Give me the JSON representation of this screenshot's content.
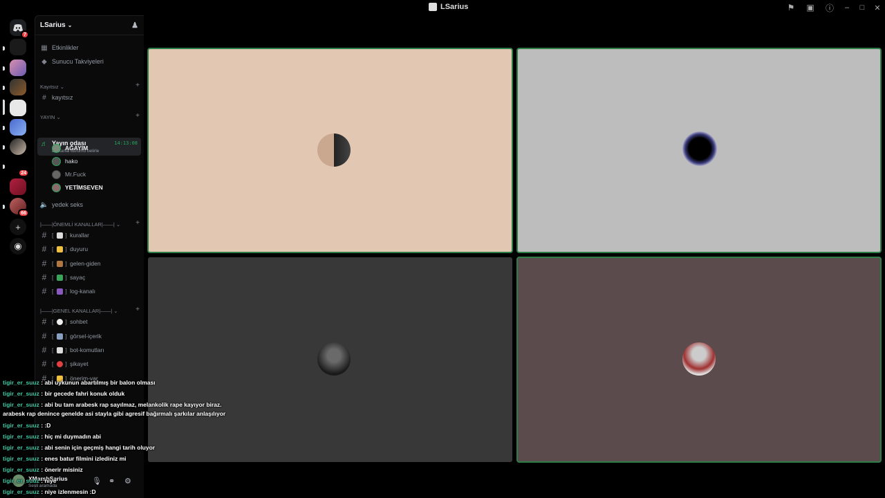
{
  "titlebar": {
    "title": "LSarius"
  },
  "server": {
    "name": "LSarius"
  },
  "rail": {
    "badges": {
      "discord": "7",
      "srv8": "24",
      "srv10": "66"
    }
  },
  "sidebar": {
    "top_items": [
      {
        "label": "Etkinlikler"
      },
      {
        "label": "Sunucu Takviyeleri"
      }
    ],
    "categories": {
      "kayitsiz": "Kayıtsız",
      "yayin": "YAYIN",
      "onemli": "|——|ÖNEMLİ KANALLAR|——|",
      "genel": "|——|GENEL KANALLAR|——|"
    },
    "kayitsiz_channel": "kayıtsız",
    "active_voice": {
      "name": "Yayın odası",
      "time": "14:13:08",
      "status": "Bir kanal durumu belirle"
    },
    "members": [
      {
        "name": "AĞAYIM"
      },
      {
        "name": "hako"
      },
      {
        "name": "Mr.Fuck"
      },
      {
        "name": "YETİMSEVEN"
      }
    ],
    "voice_other": "yedek seks",
    "important_channels": [
      {
        "label": "kurallar"
      },
      {
        "label": "duyuru"
      },
      {
        "label": "gelen-giden"
      },
      {
        "label": "sayaç"
      },
      {
        "label": "log-kanalı"
      }
    ],
    "general_channels": [
      {
        "label": "sohbet"
      },
      {
        "label": "görsel-içerik"
      },
      {
        "label": "bot-komutları"
      },
      {
        "label": "şikayet"
      },
      {
        "label": "önerim-var"
      }
    ]
  },
  "user_panel": {
    "name": "XMarshSarius",
    "status": "Sesli aramada"
  },
  "chat": [
    {
      "user": "tigir_er_suuz",
      "text": " : abi uykunun abartılmış bir balon olması"
    },
    {
      "user": "tigir_er_suuz",
      "text": " : bir gecede fahri konuk olduk"
    },
    {
      "user": "tigir_er_suuz",
      "text": " : abi bu tam arabesk rap sayılmaz, melankolik rape kayıyor biraz."
    },
    {
      "user": "",
      "text": "arabesk rap denince genelde asi stayla gibi agresif bağırmalı şarkılar anlaşılıyor"
    },
    {
      "user": "tigir_er_suuz",
      "text": " : :D"
    },
    {
      "user": "tigir_er_suuz",
      "text": " : hiç mi duymadın abi"
    },
    {
      "user": "tigir_er_suuz",
      "text": " : abi senin için geçmiş hangi tarih oluyor"
    },
    {
      "user": "tigir_er_suuz",
      "text": " : enes batur filmini izlediniz mi"
    },
    {
      "user": "tigir_er_suuz",
      "text": " : önerir misiniz"
    },
    {
      "user": "tigir_er_suuz",
      "text": " : niye"
    },
    {
      "user": "tigir_er_suuz",
      "text": " : niye izlenmesin :D"
    }
  ]
}
